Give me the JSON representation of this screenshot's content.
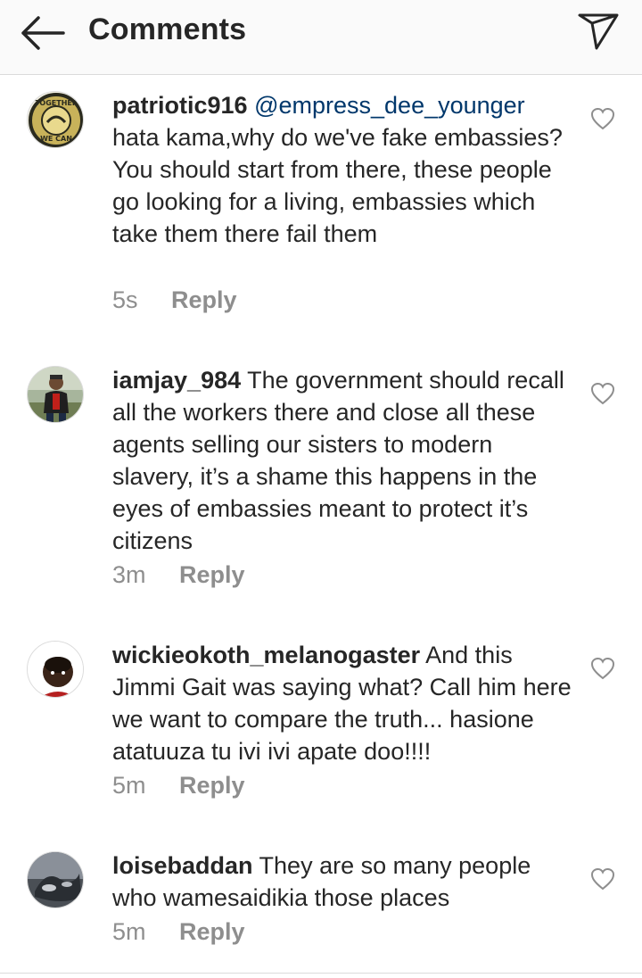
{
  "header": {
    "title": "Comments"
  },
  "comments": [
    {
      "username": "patriotic916",
      "mention": "@empress_dee_younger",
      "text": "hata kama,why do we've fake embassies? You should start from there, these people go looking for a living, embassies which take them there fail them",
      "time": "5s",
      "reply_label": "Reply",
      "avatar_text_top": "TOGETHER",
      "avatar_text_bottom": "WE CAN"
    },
    {
      "username": "iamjay_984",
      "mention": "",
      "text": "The government should recall all the workers there and close all these agents selling our sisters to modern slavery, it’s a shame this happens in the eyes of embassies meant to protect it’s citizens",
      "time": "3m",
      "reply_label": "Reply"
    },
    {
      "username": "wickieokoth_melanogaster",
      "mention": "",
      "text": "And this Jimmi Gait was saying what? Call him here we want to compare the truth... hasione atatuuza tu ivi ivi apate doo!!!!",
      "time": "5m",
      "reply_label": "Reply"
    },
    {
      "username": "loisebaddan",
      "mention": "",
      "text": "They are so many people who wamesaidikia those places",
      "time": "5m",
      "reply_label": "Reply"
    }
  ],
  "icons": {
    "back": "arrow-left-icon",
    "share": "paper-plane-icon",
    "like": "heart-outline-icon"
  },
  "colors": {
    "text": "#262626",
    "secondary": "#8e8e8e",
    "mention": "#00376b",
    "divider": "#dbdbdb",
    "header_bg": "#fafafa"
  }
}
